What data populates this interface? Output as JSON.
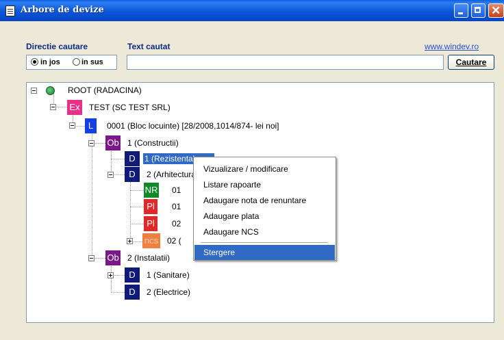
{
  "window": {
    "title": "Arbore de devize"
  },
  "search": {
    "direction_label": "Directie cautare",
    "text_label": "Text cautat",
    "link_text": "www.windev.ro",
    "radio_down": "in jos",
    "radio_up": "in sus",
    "selected_direction": "in jos",
    "text_value": "",
    "button_label": "Cautare"
  },
  "tree": {
    "root": "ROOT (RADACINA)",
    "company": {
      "badge": "Ex",
      "label": "TEST (SC TEST SRL)"
    },
    "estimate": {
      "badge": "L",
      "label": "0001 (Bloc locuinte) [28/2008,1014/874- lei noi]"
    },
    "object1": {
      "badge": "Ob",
      "label": "1 (Constructii)"
    },
    "d1": {
      "badge": "D",
      "label": "1 (Rezistenta)"
    },
    "d2": {
      "badge": "D",
      "label": "2 (Arhitectura)"
    },
    "nr": {
      "badge": "NR",
      "label": "01"
    },
    "pl1": {
      "badge": "Pl",
      "label": "01"
    },
    "pl2": {
      "badge": "Pl",
      "label": "02"
    },
    "ncs": {
      "badge": "ncs",
      "label": "02 ("
    },
    "object2": {
      "badge": "Ob",
      "label": "2 (Instalatii)"
    },
    "d3": {
      "badge": "D",
      "label": "1 (Sanitare)"
    },
    "d4": {
      "badge": "D",
      "label": "2 (Electrice)"
    }
  },
  "context_menu": {
    "items": [
      "Vizualizare / modificare",
      "Listare rapoarte",
      "Adaugare nota de renuntare",
      "Adaugare plata",
      "Adaugare NCS",
      "Stergere"
    ],
    "highlighted": "Stergere"
  },
  "colors": {
    "titlebar": "#0a56d8",
    "selection": "#316ac5",
    "badge_ex": "#e8308a",
    "badge_l": "#1240e8",
    "badge_ob": "#7a1888",
    "badge_d": "#101a78",
    "badge_nr": "#108a28",
    "badge_pl": "#e02828",
    "badge_ncs": "#f08040"
  },
  "icons": {
    "window": "document-icon",
    "root": "globe-icon",
    "minimize": "minimize-icon",
    "maximize": "maximize-icon",
    "close": "close-icon"
  }
}
